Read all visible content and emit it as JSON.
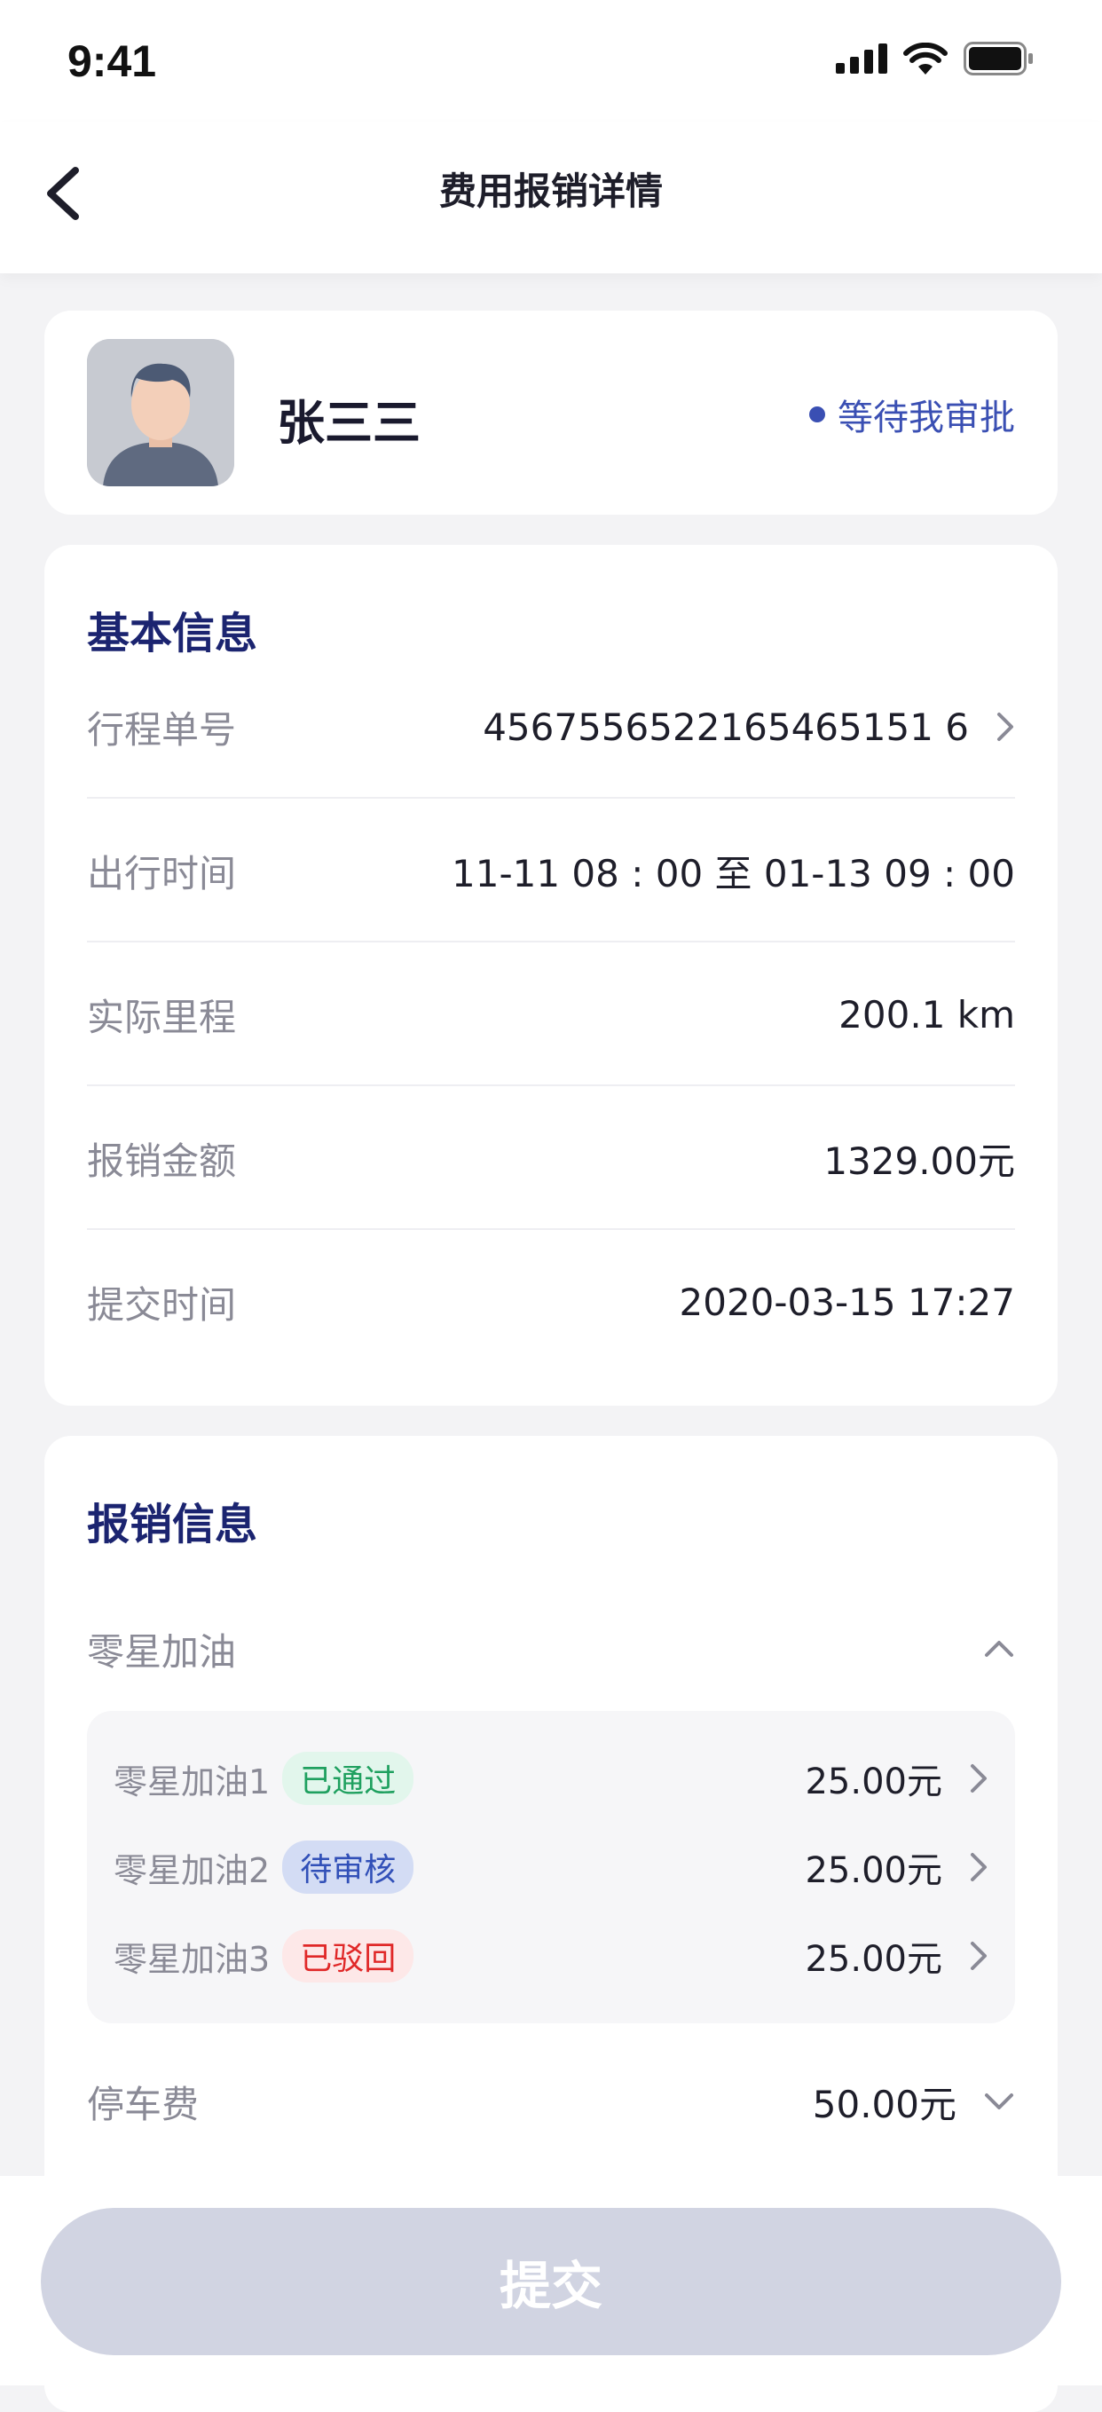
{
  "status_bar": {
    "time": "9:41"
  },
  "nav": {
    "title": "费用报销详情"
  },
  "user": {
    "name": "张三三",
    "status": "等待我审批",
    "status_color": "#3a4fb3"
  },
  "basic_info": {
    "title": "基本信息",
    "rows": [
      {
        "label": "行程单号",
        "value": "4567556522165465151 6"
      },
      {
        "label": "出行时间",
        "value": "11-11 08 : 00 至 01-13 09 : 00"
      },
      {
        "label": "实际里程",
        "value": "200.1 km"
      },
      {
        "label": "报销金额",
        "value": "1329.00元"
      },
      {
        "label": "提交时间",
        "value": "2020-03-15 17:27"
      }
    ]
  },
  "reimbursement": {
    "title": "报销信息",
    "categories": [
      {
        "label": "零星加油",
        "items": [
          {
            "label": "零星加油1",
            "tag": "已通过",
            "amount": "25.00元"
          },
          {
            "label": "零星加油2",
            "tag": "待审核",
            "amount": "25.00元"
          },
          {
            "label": "零星加油3",
            "tag": "已驳回",
            "amount": "25.00元"
          }
        ]
      },
      {
        "label": "停车费",
        "amount": "50.00元"
      }
    ]
  },
  "footer": {
    "submit_label": "提交"
  },
  "colors": {
    "accent": "#3a4fb3",
    "title_navy": "#1b2470",
    "tag_pass": "#1fa05f",
    "tag_wait": "#3150b8",
    "tag_reject": "#e02828",
    "submit_disabled": "#d1d4e2"
  }
}
